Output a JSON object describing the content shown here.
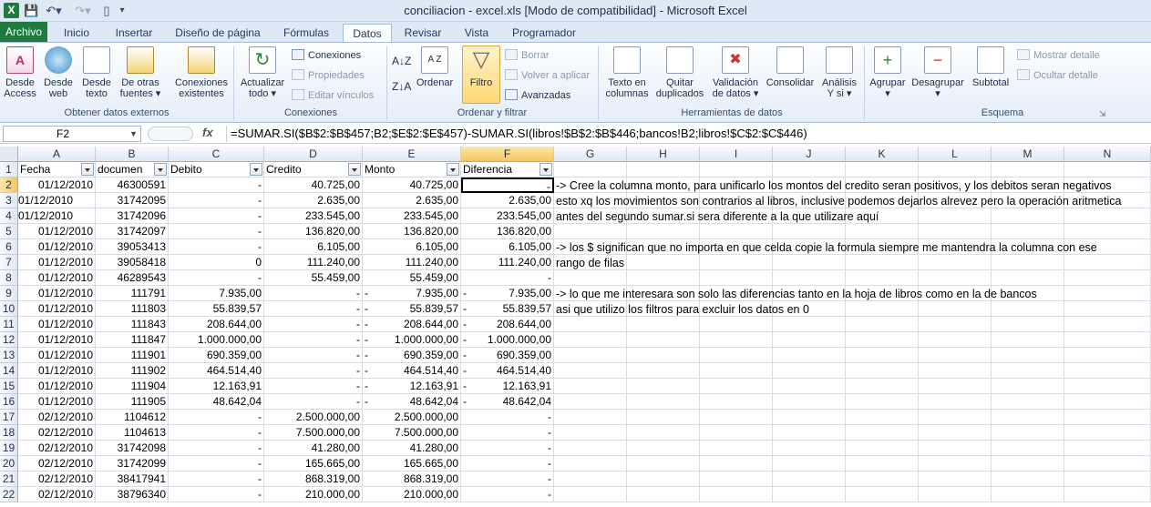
{
  "titlebar": {
    "title": "conciliacion - excel.xls  [Modo de compatibilidad]  -  Microsoft Excel",
    "app_icon": "X"
  },
  "tabs": [
    "Archivo",
    "Inicio",
    "Insertar",
    "Diseño de página",
    "Fórmulas",
    "Datos",
    "Revisar",
    "Vista",
    "Programador"
  ],
  "active_tab": "Datos",
  "ribbon": {
    "groups": {
      "obtener": "Obtener datos externos",
      "conexiones": "Conexiones",
      "ordenar": "Ordenar y filtrar",
      "herramientas": "Herramientas de datos",
      "esquema": "Esquema"
    },
    "buttons": {
      "access": [
        "Desde",
        "Access"
      ],
      "web": [
        "Desde",
        "web"
      ],
      "texto": [
        "Desde",
        "texto"
      ],
      "otras": [
        "De otras",
        "fuentes ▾"
      ],
      "existentes": [
        "Conexiones",
        "existentes"
      ],
      "actualizar": [
        "Actualizar",
        "todo ▾"
      ],
      "conexiones_small": "Conexiones",
      "propiedades": "Propiedades",
      "editar_vinculos": "Editar vínculos",
      "ordenar": "Ordenar",
      "filtro": "Filtro",
      "borrar": "Borrar",
      "volver": "Volver a aplicar",
      "avanzadas": "Avanzadas",
      "texto_columnas": [
        "Texto en",
        "columnas"
      ],
      "quitar_dup": [
        "Quitar",
        "duplicados"
      ],
      "validacion": [
        "Validación",
        "de datos ▾"
      ],
      "consolidar": [
        "Consolidar",
        ""
      ],
      "analisis": [
        "Análisis",
        "Y si ▾"
      ],
      "agrupar": [
        "Agrupar",
        "▾"
      ],
      "desagrupar": [
        "Desagrupar",
        "▾"
      ],
      "subtotal": [
        "Subtotal",
        ""
      ],
      "mostrar_detalle": "Mostrar detalle",
      "ocultar_detalle": "Ocultar detalle"
    }
  },
  "formula_bar": {
    "name_box": "F2",
    "fx": "fx",
    "formula": "=SUMAR.SI($B$2:$B$457;B2;$E$2:$E$457)-SUMAR.SI(libros!$B$2:$B$446;bancos!B2;libros!$C$2:$C$446)"
  },
  "columns": [
    "A",
    "B",
    "C",
    "D",
    "E",
    "F",
    "G",
    "H",
    "I",
    "J",
    "K",
    "L",
    "M",
    "N"
  ],
  "headers": [
    "Fecha",
    "documen",
    "Debito",
    "Credito",
    "Monto",
    "Diferencia"
  ],
  "rows": [
    {
      "n": "2",
      "a": "01/12/2010",
      "b": "46300591",
      "c": "-",
      "d": "40.725,00",
      "e": "40.725,00",
      "f": "-"
    },
    {
      "n": "3",
      "a": "01/12/2010",
      "b": "31742095",
      "c": "-",
      "d": "2.635,00",
      "e": "2.635,00",
      "f": "2.635,00"
    },
    {
      "n": "4",
      "a": "01/12/2010",
      "b": "31742096",
      "c": "-",
      "d": "233.545,00",
      "e": "233.545,00",
      "f": "233.545,00"
    },
    {
      "n": "5",
      "a": "01/12/2010",
      "b": "31742097",
      "c": "-",
      "d": "136.820,00",
      "e": "136.820,00",
      "f": "136.820,00"
    },
    {
      "n": "6",
      "a": "01/12/2010",
      "b": "39053413",
      "c": "-",
      "d": "6.105,00",
      "e": "6.105,00",
      "f": "6.105,00"
    },
    {
      "n": "7",
      "a": "01/12/2010",
      "b": "39058418",
      "c": "0",
      "d": "111.240,00",
      "e": "111.240,00",
      "f": "111.240,00"
    },
    {
      "n": "8",
      "a": "01/12/2010",
      "b": "46289543",
      "c": "-",
      "d": "55.459,00",
      "e": "55.459,00",
      "f": "-"
    },
    {
      "n": "9",
      "a": "01/12/2010",
      "b": "111791",
      "c": "7.935,00",
      "d": "-",
      "e": "7.935,00",
      "f": "7.935,00",
      "neg": true
    },
    {
      "n": "10",
      "a": "01/12/2010",
      "b": "111803",
      "c": "55.839,57",
      "d": "-",
      "e": "55.839,57",
      "f": "55.839,57",
      "neg": true
    },
    {
      "n": "11",
      "a": "01/12/2010",
      "b": "111843",
      "c": "208.644,00",
      "d": "-",
      "e": "208.644,00",
      "f": "208.644,00",
      "neg": true
    },
    {
      "n": "12",
      "a": "01/12/2010",
      "b": "111847",
      "c": "1.000.000,00",
      "d": "-",
      "e": "1.000.000,00",
      "f": "1.000.000,00",
      "neg": true
    },
    {
      "n": "13",
      "a": "01/12/2010",
      "b": "111901",
      "c": "690.359,00",
      "d": "-",
      "e": "690.359,00",
      "f": "690.359,00",
      "neg": true
    },
    {
      "n": "14",
      "a": "01/12/2010",
      "b": "111902",
      "c": "464.514,40",
      "d": "-",
      "e": "464.514,40",
      "f": "464.514,40",
      "neg": true
    },
    {
      "n": "15",
      "a": "01/12/2010",
      "b": "111904",
      "c": "12.163,91",
      "d": "-",
      "e": "12.163,91",
      "f": "12.163,91",
      "neg": true
    },
    {
      "n": "16",
      "a": "01/12/2010",
      "b": "111905",
      "c": "48.642,04",
      "d": "-",
      "e": "48.642,04",
      "f": "48.642,04",
      "neg": true
    },
    {
      "n": "17",
      "a": "02/12/2010",
      "b": "1104612",
      "c": "-",
      "d": "2.500.000,00",
      "e": "2.500.000,00",
      "f": "-"
    },
    {
      "n": "18",
      "a": "02/12/2010",
      "b": "1104613",
      "c": "-",
      "d": "7.500.000,00",
      "e": "7.500.000,00",
      "f": "-"
    },
    {
      "n": "19",
      "a": "02/12/2010",
      "b": "31742098",
      "c": "-",
      "d": "41.280,00",
      "e": "41.280,00",
      "f": "-"
    },
    {
      "n": "20",
      "a": "02/12/2010",
      "b": "31742099",
      "c": "-",
      "d": "165.665,00",
      "e": "165.665,00",
      "f": "-"
    },
    {
      "n": "21",
      "a": "02/12/2010",
      "b": "38417941",
      "c": "-",
      "d": "868.319,00",
      "e": "868.319,00",
      "f": "-"
    },
    {
      "n": "22",
      "a": "02/12/2010",
      "b": "38796340",
      "c": "-",
      "d": "210.000,00",
      "e": "210.000,00",
      "f": "-"
    }
  ],
  "notes": [
    "-> Cree la columna monto, para unificarlo los montos del credito seran positivos, y los debitos seran negativos",
    "esto xq los movimientos son contrarios al libros, inclusive podemos dejarlos alrevez pero la operación aritmetica",
    "antes del segundo sumar.si sera diferente a la que utilizare aquí",
    "",
    "-> los $ significan que no importa en que celda copie la formula siempre me mantendra la columna con ese",
    "rango de filas",
    "",
    "-> lo que me interesara son solo las diferencias tanto en la hoja de libros como en la de bancos",
    "asi que utilizo los filtros para excluir los datos en 0"
  ],
  "colors": {
    "file_tab": "#1f7a3e",
    "selection": "#f4c75d",
    "ribbon_bg": "#e4edf8"
  }
}
